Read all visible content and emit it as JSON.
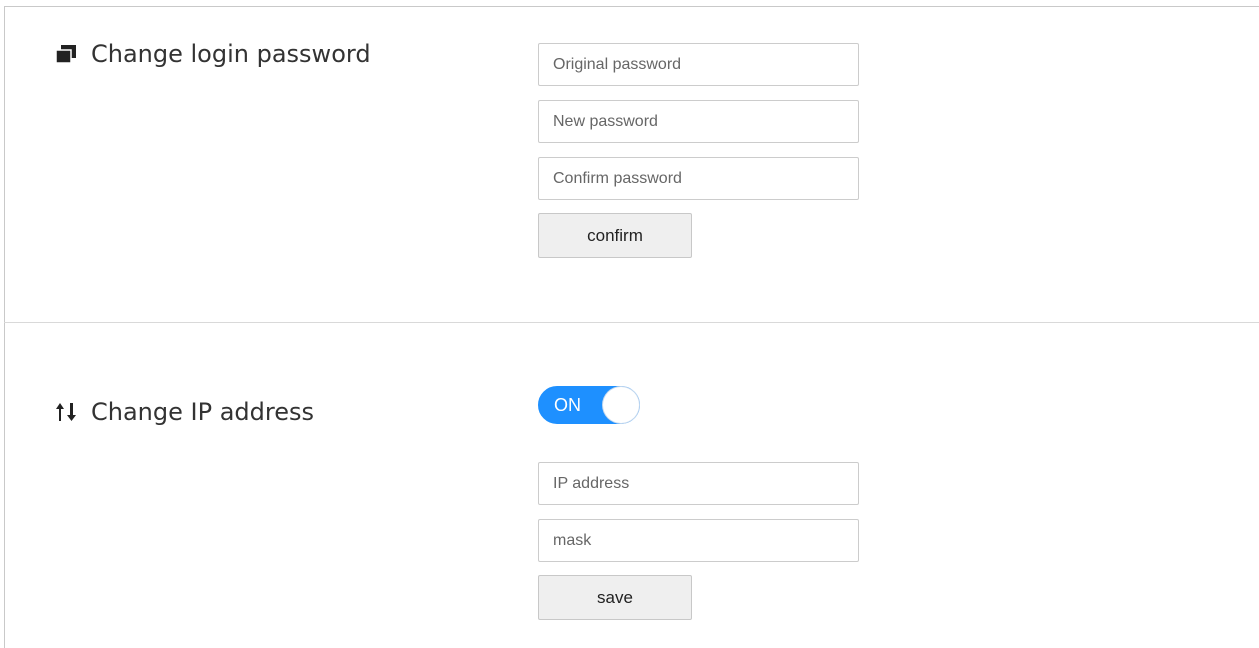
{
  "password_section": {
    "icon": "window-stack-icon",
    "title": "Change login password",
    "original_password_placeholder": "Original password",
    "new_password_placeholder": "New password",
    "confirm_password_placeholder": "Confirm password",
    "confirm_button_label": "confirm"
  },
  "ip_section": {
    "icon": "arrows-up-down-icon",
    "title": "Change IP address",
    "toggle_label": "ON",
    "toggle_state": true,
    "ip_address_placeholder": "IP address",
    "mask_placeholder": "mask",
    "save_button_label": "save"
  },
  "colors": {
    "toggle_on": "#1e90ff",
    "text": "#333333",
    "button_bg": "#efefef"
  }
}
